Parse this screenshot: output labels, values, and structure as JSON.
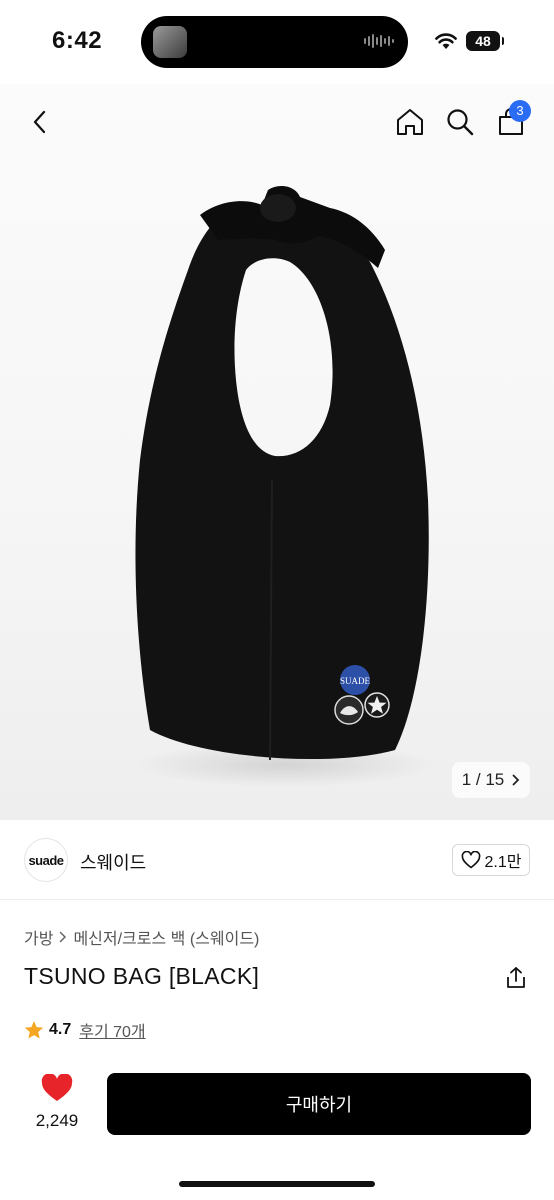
{
  "status": {
    "time": "6:42",
    "battery": "48"
  },
  "product": {
    "image_counter": "1 / 15",
    "brand_logo_text": "suade",
    "brand_name": "스웨이드",
    "brand_likes": "2.1만",
    "breadcrumb": [
      "가방",
      "메신저/크로스 백 (스웨이드)"
    ],
    "title": "TSUNO BAG [BLACK]",
    "rating": "4.7",
    "reviews": "후기 70개",
    "pin_text": "SUADE"
  },
  "header": {
    "cart_count": "3"
  },
  "bottom_bar": {
    "wish_count": "2,249",
    "buy_label": "구매하기"
  },
  "colors": {
    "accent": "#2b6cf5",
    "wish_heart": "#e8242b",
    "star": "#f5a623",
    "button": "#000000"
  },
  "icons": [
    "back-icon",
    "home-icon",
    "search-icon",
    "cart-icon",
    "chevron-right-icon",
    "heart-outline-icon",
    "share-icon",
    "star-icon",
    "heart-filled-icon"
  ]
}
